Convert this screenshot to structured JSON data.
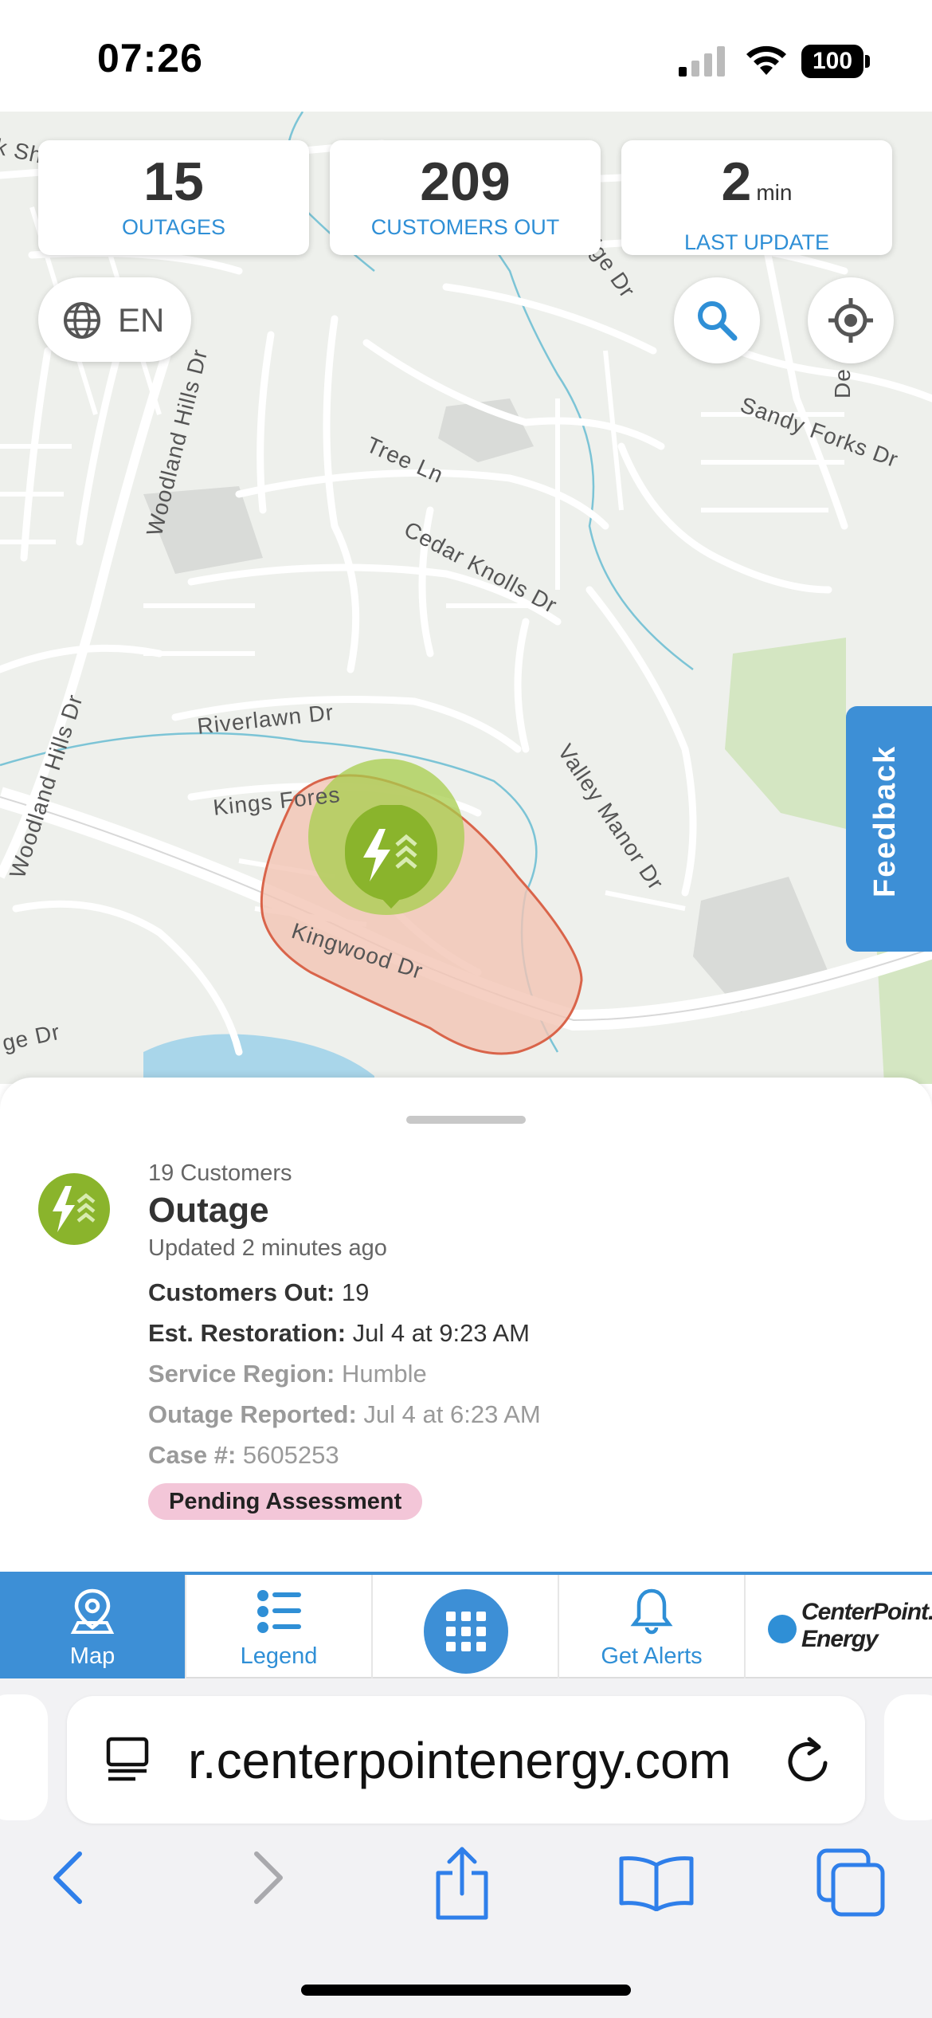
{
  "status_bar": {
    "time": "07:26",
    "battery": "100"
  },
  "stats": {
    "outages": {
      "value": "15",
      "label": "OUTAGES"
    },
    "customers_out": {
      "value": "209",
      "label": "CUSTOMERS OUT"
    },
    "last_update": {
      "value": "2",
      "unit": "min",
      "label": "LAST UPDATE"
    }
  },
  "map": {
    "language": "EN",
    "feedback_label": "Feedback",
    "street_labels": {
      "shores": "k Shores Dr",
      "sandy_forks": "Sandy Forks Dr",
      "tree": "Tree Ln",
      "cedar_knolls": "Cedar Knolls Dr",
      "woodland_hills_top": "Woodland Hills Dr",
      "woodland_hills_left": "Woodland Hills Dr",
      "riverlawn": "Riverlawn Dr",
      "kings_forest": "Kings Fores",
      "valley_manor": "Valley Manor Dr",
      "kingwood": "Kingwood Dr",
      "ge": "ge Dr",
      "ridge": "dge Dr",
      "de": "De"
    },
    "colors": {
      "land": "#eef0ec",
      "road": "#ffffff",
      "water": "#7cc4d6",
      "park": "#d4e6c2",
      "outage_area": "#f2c4b4",
      "outage_border": "#d9644a",
      "marker": "#8ab42c"
    }
  },
  "outage_detail": {
    "customers": "19 Customers",
    "title": "Outage",
    "updated": "Updated 2 minutes ago",
    "customers_out_label": "Customers Out:",
    "customers_out_value": "19",
    "est_restoration_label": "Est. Restoration:",
    "est_restoration_value": "Jul 4 at 9:23 AM",
    "service_region_label": "Service Region:",
    "service_region_value": "Humble",
    "reported_label": "Outage Reported:",
    "reported_value": "Jul 4 at 6:23 AM",
    "case_label": "Case #:",
    "case_value": "5605253",
    "status_badge": "Pending Assessment",
    "badge_color": "#f3c6d8"
  },
  "nav": {
    "map": "Map",
    "legend": "Legend",
    "alerts": "Get Alerts",
    "logo_line1": "CenterPoint.",
    "logo_line2": "Energy",
    "accent": "#3d8fd6"
  },
  "browser": {
    "url": "r.centerpointenergy.com"
  }
}
